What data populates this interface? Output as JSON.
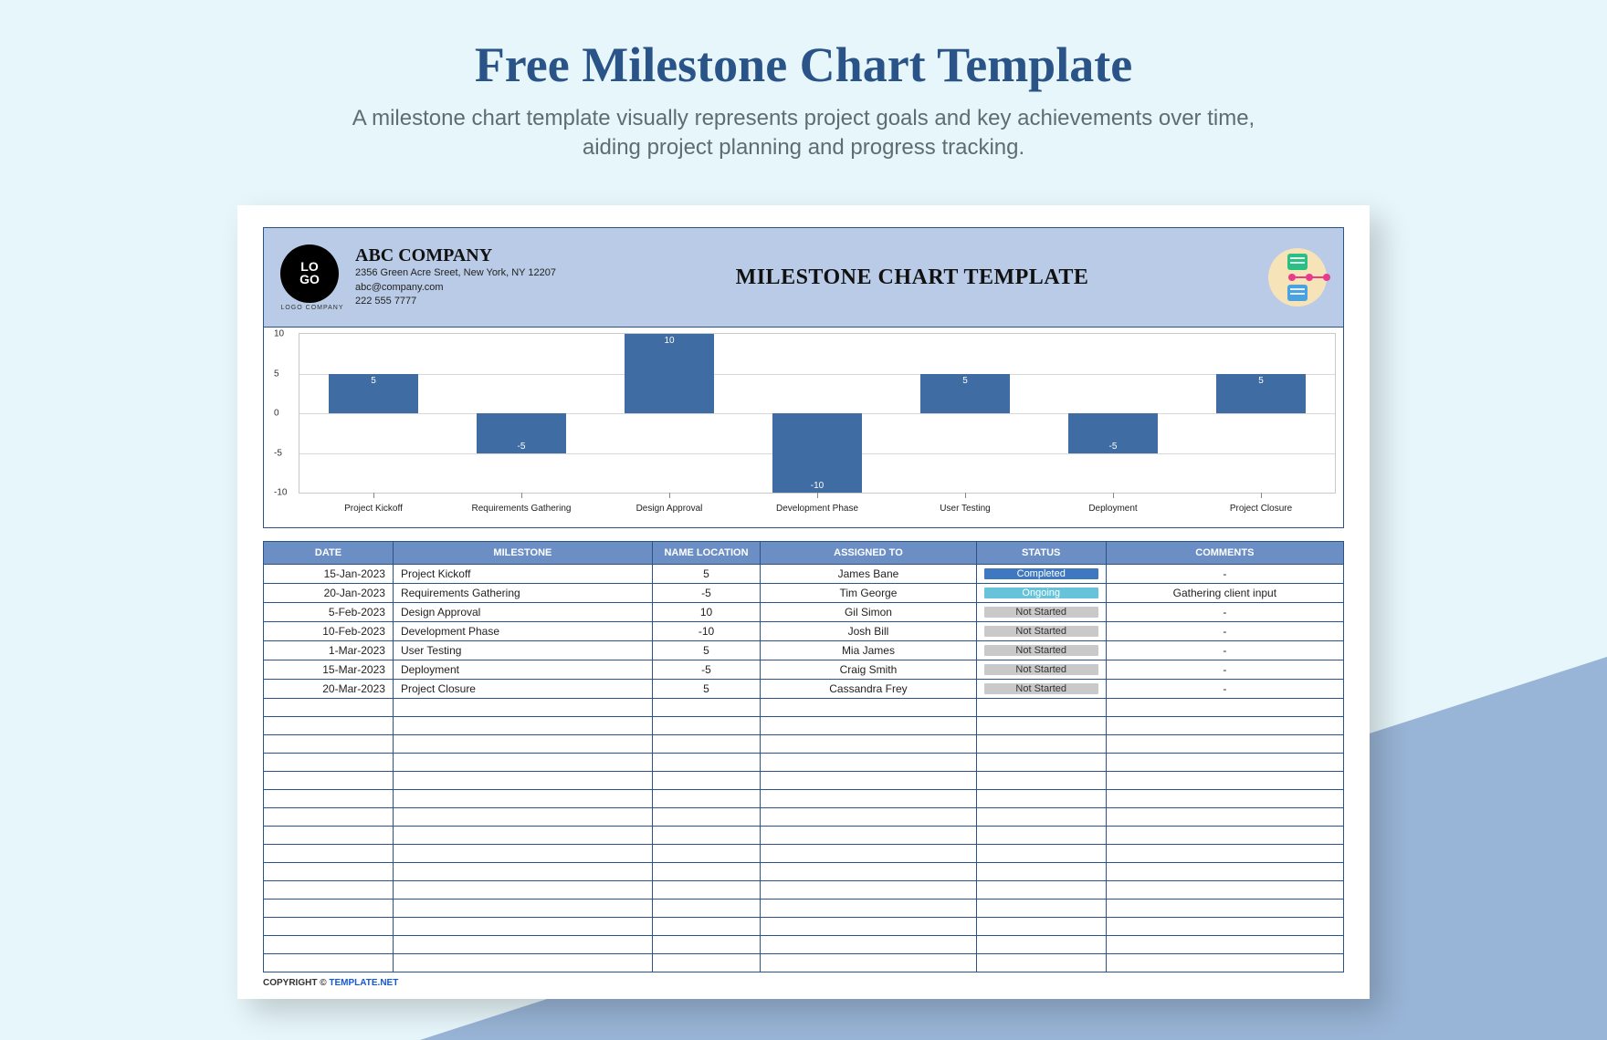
{
  "page": {
    "title": "Free Milestone Chart Template",
    "subtitle": "A milestone chart template visually represents project goals and key achievements over time, aiding project planning and progress tracking."
  },
  "header": {
    "logo_top": "LO",
    "logo_bot": "GO",
    "logo_caption": "LOGO COMPANY",
    "company": "ABC COMPANY",
    "address": "2356 Green Acre Sreet, New York, NY 12207",
    "email": "abc@company.com",
    "phone": "222 555 7777",
    "title": "MILESTONE CHART TEMPLATE"
  },
  "chart_data": {
    "type": "bar",
    "categories": [
      "Project Kickoff",
      "Requirements Gathering",
      "Design Approval",
      "Development Phase",
      "User Testing",
      "Deployment",
      "Project Closure"
    ],
    "values": [
      5,
      -5,
      10,
      -10,
      5,
      -5,
      5
    ],
    "title": "",
    "xlabel": "",
    "ylabel": "",
    "ylim": [
      -10,
      10
    ],
    "yticks": [
      -10,
      -5,
      0,
      5,
      10
    ]
  },
  "table": {
    "headers": [
      "DATE",
      "MILESTONE",
      "NAME LOCATION",
      "ASSIGNED TO",
      "STATUS",
      "COMMENTS"
    ],
    "rows": [
      {
        "date": "15-Jan-2023",
        "milestone": "Project Kickoff",
        "loc": "5",
        "assigned": "James Bane",
        "status": "Completed",
        "comments": "-"
      },
      {
        "date": "20-Jan-2023",
        "milestone": "Requirements Gathering",
        "loc": "-5",
        "assigned": "Tim George",
        "status": "Ongoing",
        "comments": "Gathering client input"
      },
      {
        "date": "5-Feb-2023",
        "milestone": "Design Approval",
        "loc": "10",
        "assigned": "Gil Simon",
        "status": "Not Started",
        "comments": "-"
      },
      {
        "date": "10-Feb-2023",
        "milestone": "Development Phase",
        "loc": "-10",
        "assigned": "Josh Bill",
        "status": "Not Started",
        "comments": "-"
      },
      {
        "date": "1-Mar-2023",
        "milestone": "User Testing",
        "loc": "5",
        "assigned": "Mia James",
        "status": "Not Started",
        "comments": "-"
      },
      {
        "date": "15-Mar-2023",
        "milestone": "Deployment",
        "loc": "-5",
        "assigned": "Craig Smith",
        "status": "Not Started",
        "comments": "-"
      },
      {
        "date": "20-Mar-2023",
        "milestone": "Project Closure",
        "loc": "5",
        "assigned": "Cassandra Frey",
        "status": "Not Started",
        "comments": "-"
      }
    ],
    "empty_rows": 15
  },
  "footer": {
    "copyright_label": "COPYRIGHT ©",
    "link": "TEMPLATE.NET"
  }
}
